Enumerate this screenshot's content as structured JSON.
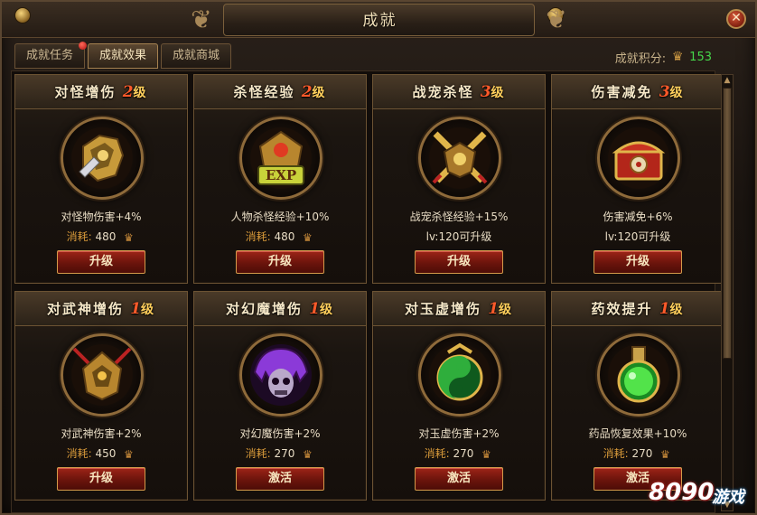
{
  "window": {
    "title": "成就",
    "close_label": "✕"
  },
  "tabs": [
    {
      "label": "成就任务",
      "active": false,
      "has_notice": true
    },
    {
      "label": "成就效果",
      "active": true,
      "has_notice": false
    },
    {
      "label": "成就商城",
      "active": false,
      "has_notice": false
    }
  ],
  "points": {
    "label": "成就积分:",
    "value": "153"
  },
  "cards": [
    {
      "name": "对怪增伤",
      "level": "2",
      "level_suffix": "级",
      "icon": "dragon-axe-icon",
      "desc": "对怪物伤害+4%",
      "cost_label": "消耗:",
      "cost": "480",
      "req": "",
      "button": "升级"
    },
    {
      "name": "杀怪经验",
      "level": "2",
      "level_suffix": "级",
      "icon": "exp-emblem-icon",
      "desc": "人物杀怪经验+10%",
      "cost_label": "消耗:",
      "cost": "480",
      "req": "",
      "button": "升级"
    },
    {
      "name": "战宠杀怪",
      "level": "3",
      "level_suffix": "级",
      "icon": "crossed-swords-icon",
      "desc": "战宠杀怪经验+15%",
      "cost_label": "",
      "cost": "",
      "req": "lv:120可升级",
      "button": "升级"
    },
    {
      "name": "伤害减免",
      "level": "3",
      "level_suffix": "级",
      "icon": "treasure-chest-icon",
      "desc": "伤害减免+6%",
      "cost_label": "",
      "cost": "",
      "req": "lv:120可升级",
      "button": "升级"
    },
    {
      "name": "对武神增伤",
      "level": "1",
      "level_suffix": "级",
      "icon": "warrior-helm-icon",
      "desc": "对武神伤害+2%",
      "cost_label": "消耗:",
      "cost": "450",
      "req": "",
      "button": "升级"
    },
    {
      "name": "对幻魔增伤",
      "level": "1",
      "level_suffix": "级",
      "icon": "demon-skull-icon",
      "desc": "对幻魔伤害+2%",
      "cost_label": "消耗:",
      "cost": "270",
      "req": "",
      "button": "激活"
    },
    {
      "name": "对玉虚增伤",
      "level": "1",
      "level_suffix": "级",
      "icon": "yin-yang-icon",
      "desc": "对玉虚伤害+2%",
      "cost_label": "消耗:",
      "cost": "270",
      "req": "",
      "button": "激活"
    },
    {
      "name": "药效提升",
      "level": "1",
      "level_suffix": "级",
      "icon": "potion-flask-icon",
      "desc": "药品恢复效果+10%",
      "cost_label": "消耗:",
      "cost": "270",
      "req": "",
      "button": "激活"
    }
  ],
  "watermark": {
    "number": "8090",
    "text": "游戏"
  },
  "colors": {
    "level": "#ff5a2a",
    "points": "#45d64a",
    "button": "#9d2417",
    "frame": "#6c5333"
  }
}
